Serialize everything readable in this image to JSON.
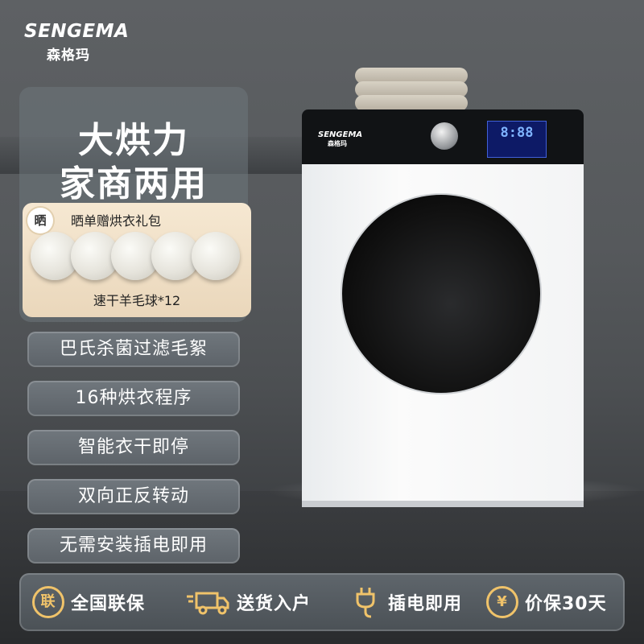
{
  "brand": {
    "name_en": "SENGEMA",
    "name_cn": "森格玛"
  },
  "headline": {
    "line1": "大烘力",
    "line2": "家商两用"
  },
  "gift": {
    "badge": "晒",
    "title": "晒单赠烘衣礼包",
    "subtitle": "速干羊毛球*12"
  },
  "features": [
    {
      "label": "巴氏杀菌过滤毛絮"
    },
    {
      "label": "16种烘衣程序"
    },
    {
      "label": "智能衣干即停"
    },
    {
      "label": "双向正反转动"
    },
    {
      "label": "无需安装插电即用"
    }
  ],
  "dryer": {
    "logo_en": "SENGEMA",
    "logo_cn": "森格玛",
    "display": "8:88"
  },
  "guarantees": [
    {
      "icon": "lian-badge-icon",
      "icon_char": "联",
      "label": "全国联保"
    },
    {
      "icon": "truck-icon",
      "label": "送货入户"
    },
    {
      "icon": "plug-icon",
      "label": "插电即用"
    },
    {
      "icon": "yuan-icon",
      "icon_char": "¥",
      "label": "价保30天"
    }
  ],
  "colors": {
    "accent_gold": "#f0c36a",
    "panel_gray": "#6b7278"
  }
}
